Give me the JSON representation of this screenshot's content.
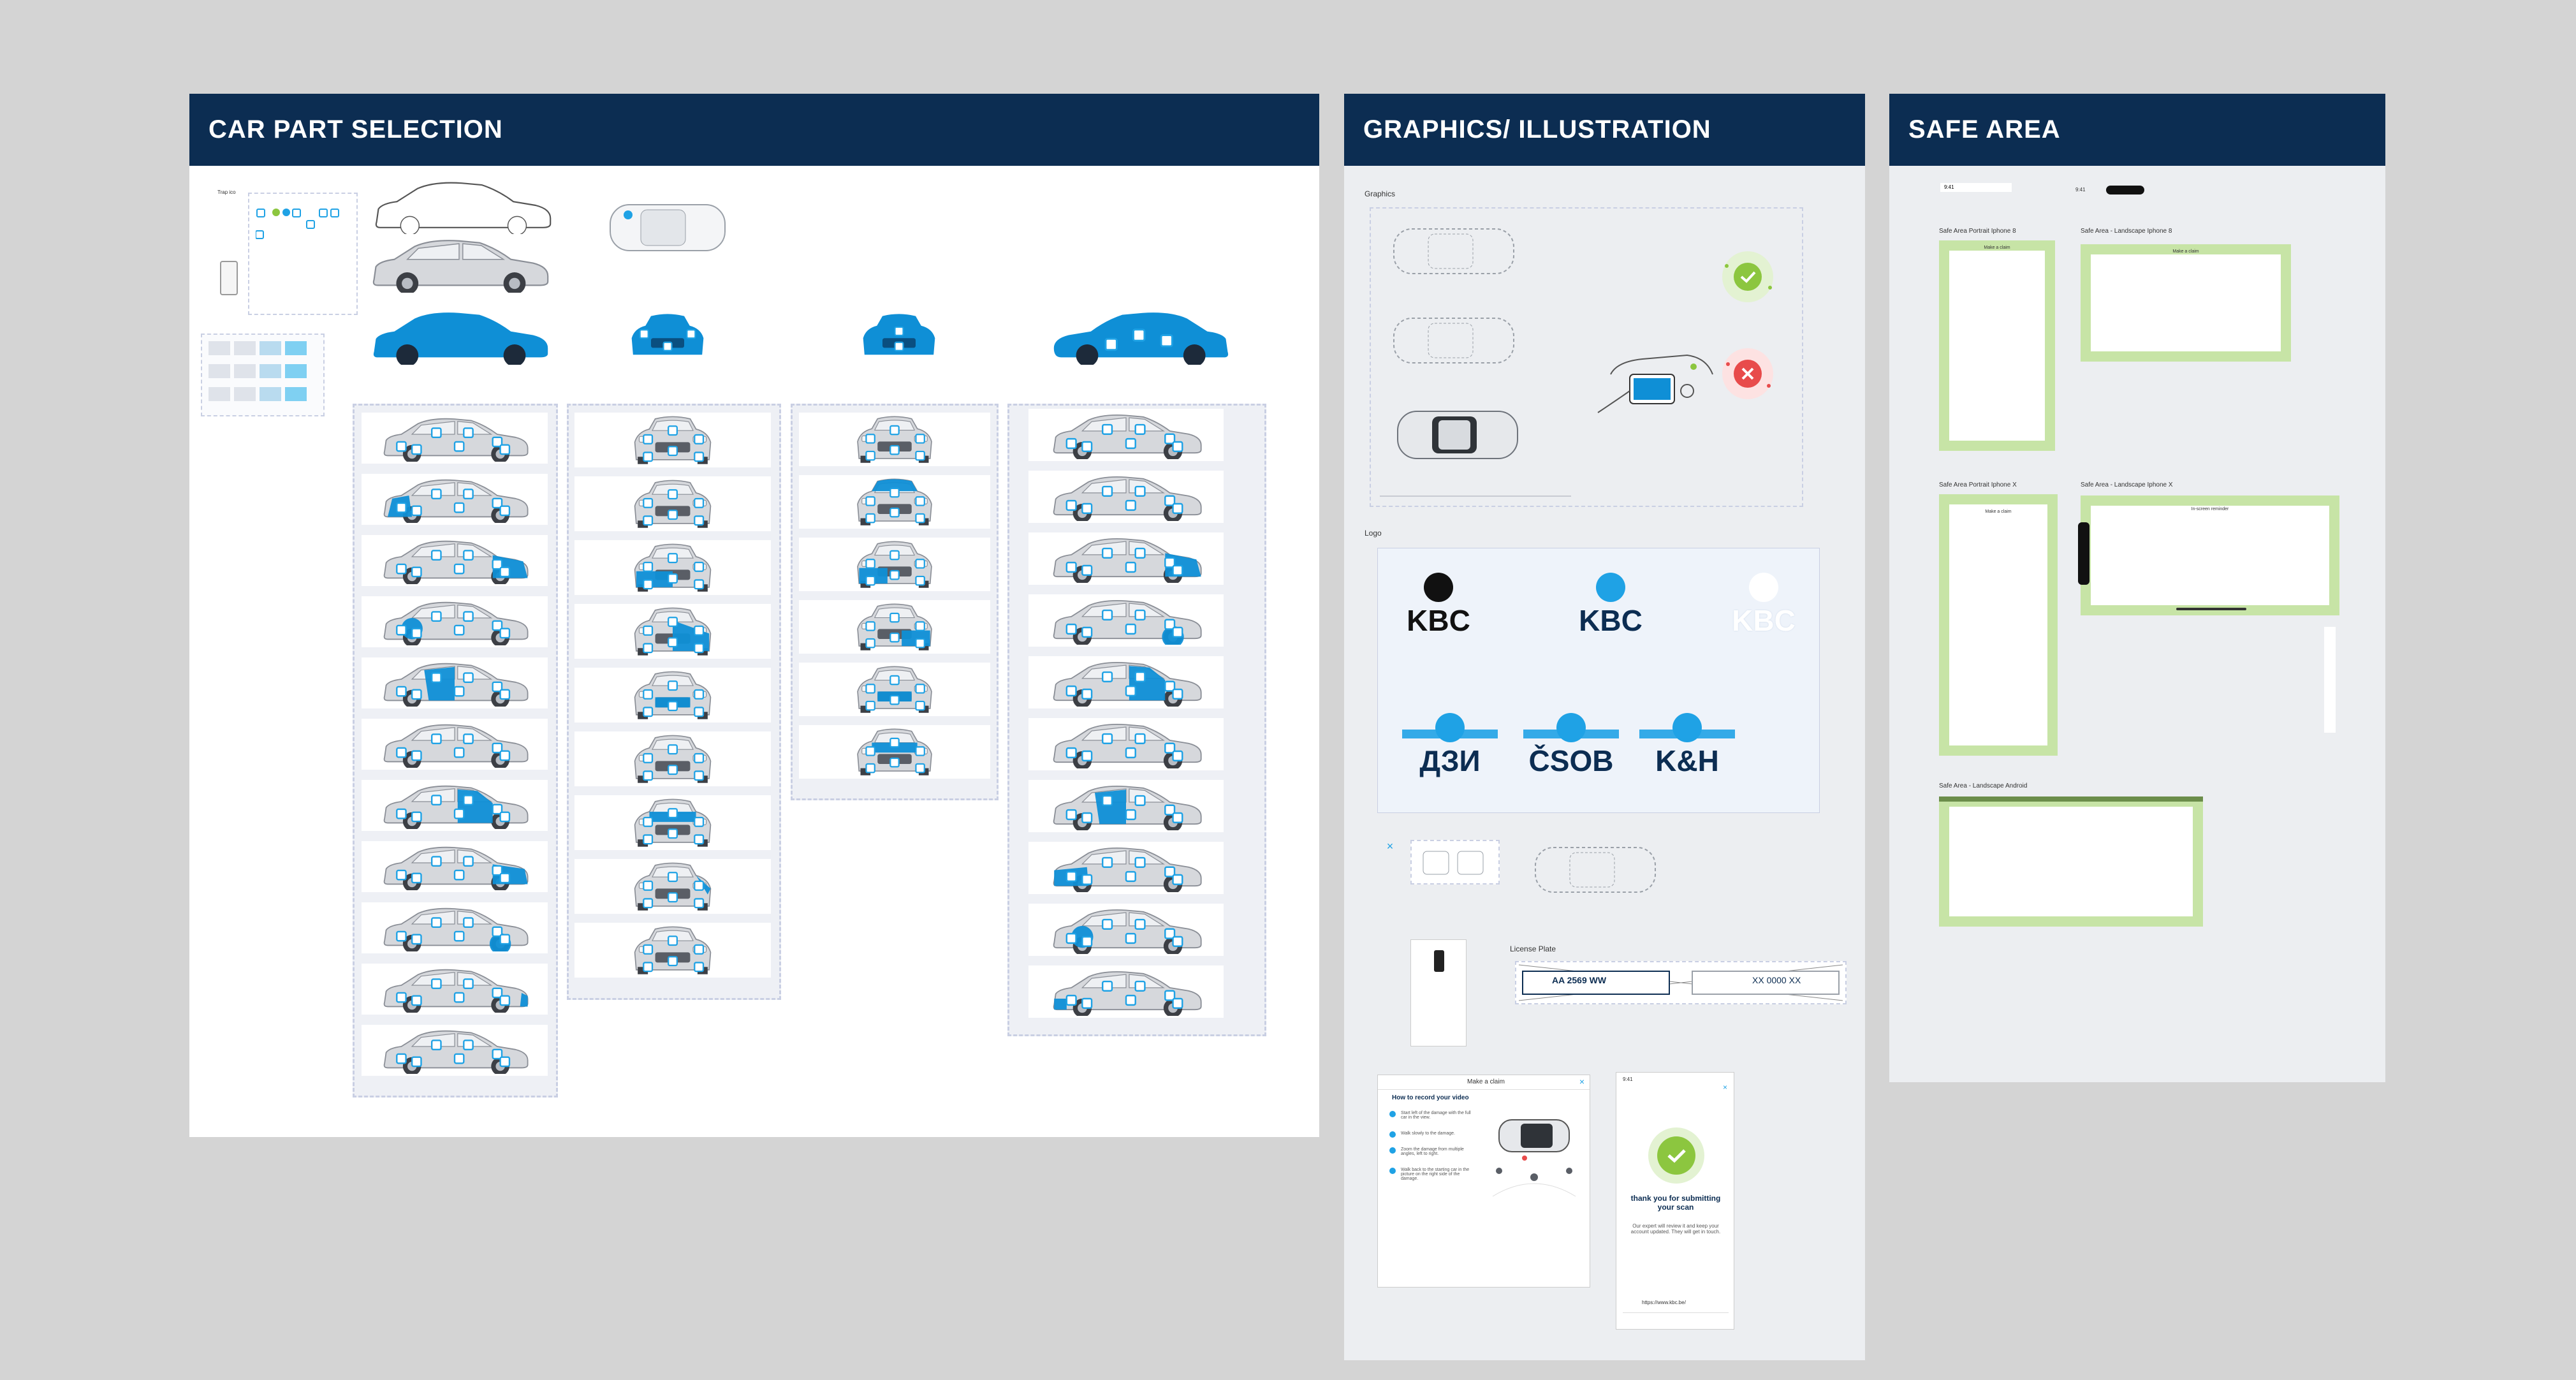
{
  "panels": {
    "car_part_selection": {
      "title": "CAR PART SELECTION"
    },
    "graphics": {
      "title": "GRAPHICS/ ILLUSTRATION",
      "graphics_label": "Graphics",
      "logo_label": "Logo",
      "license_plate_label": "License Plate",
      "plate_value": "AA 2569 WW",
      "plate_placeholder": "XX 0000 XX",
      "logos": [
        "KBC",
        "KBC",
        "KBC",
        "ДЗИ",
        "ČSOB",
        "K&H"
      ]
    },
    "safe_area": {
      "title": "SAFE AREA",
      "status_time": "9:41",
      "frames": [
        {
          "label": "Safe Area Portrait Iphone 8",
          "bar": "Make a claim"
        },
        {
          "label": "Safe Area - Landscape Iphone 8",
          "bar": "Make a claim"
        },
        {
          "label": "Safe Area Portrait Iphone X",
          "bar": "Make a claim"
        },
        {
          "label": "Safe Area - Landscape Iphone X",
          "bar": "In-screen reminder"
        },
        {
          "label": "Safe Area - Landscape Android",
          "bar": ""
        }
      ]
    }
  },
  "how_to_record": {
    "window_title": "Make a claim",
    "heading": "How to record your video",
    "steps": [
      "Start left of the damage with the full car in the view.",
      "Walk slowly to the damage.",
      "Zoom the damage from multiple angles, left to right.",
      "Walk back to the starting car in the picture on the right side of the damage."
    ]
  },
  "thank_you": {
    "time": "9:41",
    "heading": "thank you for submitting your scan",
    "body": "Our expert will review it and keep your account updated. They will get in touch.",
    "url": "https://www.kbc.be/"
  },
  "colors": {
    "header": "#0c2d52",
    "accent_blue": "#0f8fd6",
    "light_blue": "#7fd0f2",
    "green": "#8cc63f",
    "red": "#e84b4b",
    "green_frame": "#c7e4a6"
  }
}
